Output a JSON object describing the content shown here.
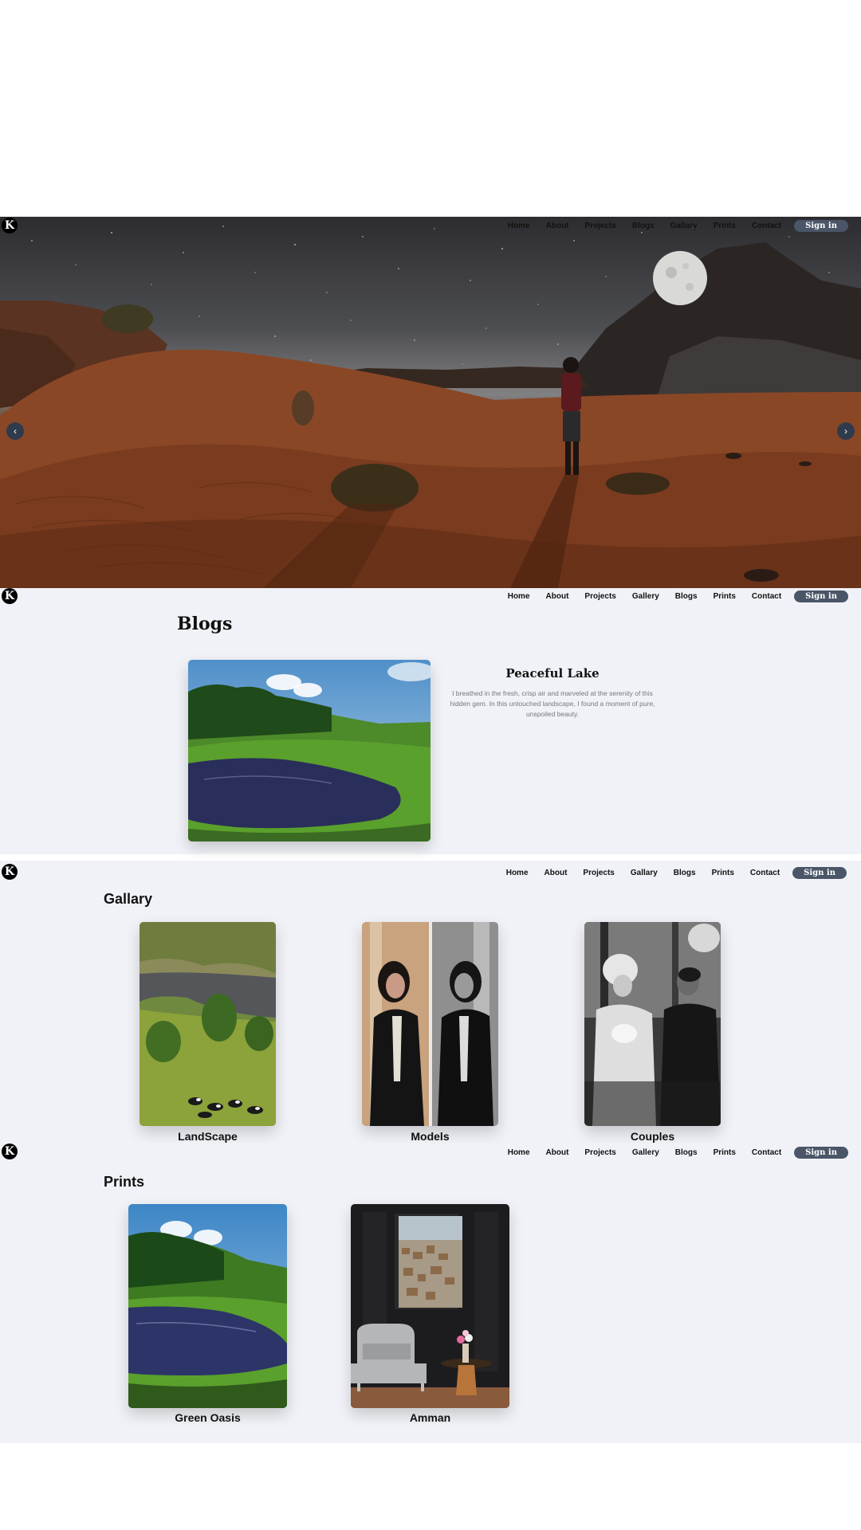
{
  "brand": {
    "logo_letter": "K"
  },
  "nav": {
    "hero_items": [
      "Home",
      "About",
      "Projects",
      "Blogs",
      "Gallary",
      "Prints",
      "Contact"
    ],
    "items": [
      "Home",
      "About",
      "Projects",
      "Gallery",
      "Blogs",
      "Prints",
      "Contact"
    ],
    "gallery_items": [
      "Home",
      "About",
      "Projects",
      "Gallary",
      "Blogs",
      "Prints",
      "Contact"
    ],
    "signin_label": "Sign in"
  },
  "hero": {
    "prev_icon": "‹",
    "next_icon": "›"
  },
  "blogs": {
    "title": "Blogs",
    "post_title": "Peaceful Lake",
    "post_text": "I breathed in the fresh, crisp air and marveled at the serenity of this hidden gem. In this untouched landscape, I found a moment of pure, unspoiled beauty."
  },
  "gallery": {
    "title": "Gallary",
    "items": [
      {
        "label": "LandScape"
      },
      {
        "label": "Models"
      },
      {
        "label": "Couples"
      }
    ]
  },
  "prints": {
    "title": "Prints",
    "items": [
      {
        "label": "Green Oasis"
      },
      {
        "label": "Amman"
      }
    ]
  },
  "colors": {
    "section_bg": "#f0f2f7",
    "signin_bg": "#4a5568",
    "arrow_bg": "#2f3a4c"
  }
}
